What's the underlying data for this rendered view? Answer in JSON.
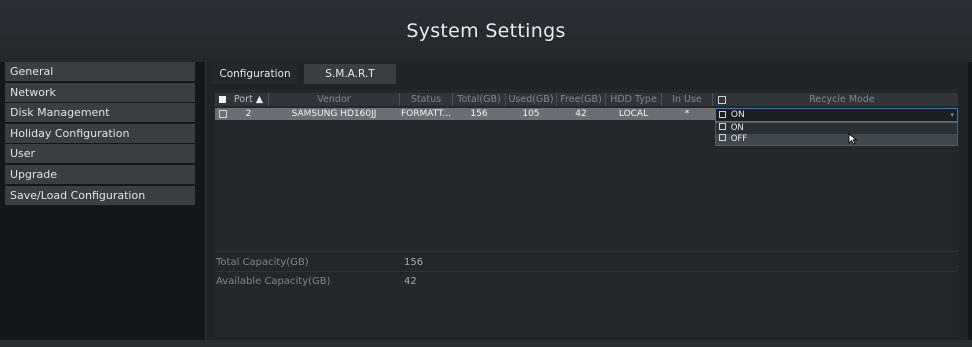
{
  "header": {
    "title": "System Settings"
  },
  "sidebar": {
    "items": [
      {
        "label": "General"
      },
      {
        "label": "Network"
      },
      {
        "label": "Disk Management"
      },
      {
        "label": "Holiday Configuration"
      },
      {
        "label": "User"
      },
      {
        "label": "Upgrade"
      },
      {
        "label": "Save/Load Configuration"
      }
    ]
  },
  "tabs": [
    {
      "label": "Configuration"
    },
    {
      "label": "S.M.A.R.T"
    }
  ],
  "table": {
    "columns": {
      "port": "Port",
      "vendor": "Vendor",
      "status": "Status",
      "total": "Total(GB)",
      "used": "Used(GB)",
      "free": "Free(GB)",
      "hdd_type": "HDD Type",
      "in_use": "In Use",
      "recycle_mode": "Recycle Mode"
    },
    "row": {
      "port": "2",
      "vendor": "SAMSUNG HD160JJ",
      "status": "FORMATT...",
      "total": "156",
      "used": "105",
      "free": "42",
      "hdd_type": "LOCAL",
      "in_use": "*"
    }
  },
  "recycle_dropdown": {
    "selected": "ON",
    "options": [
      "ON",
      "OFF"
    ]
  },
  "summary": {
    "total_label": "Total Capacity(GB)",
    "total_value": "156",
    "available_label": "Available Capacity(GB)",
    "available_value": "42"
  },
  "colors": {
    "accent": "#3b78a8",
    "sidebar_item": "#3a3e41",
    "selected_row": "#6b6f73"
  }
}
